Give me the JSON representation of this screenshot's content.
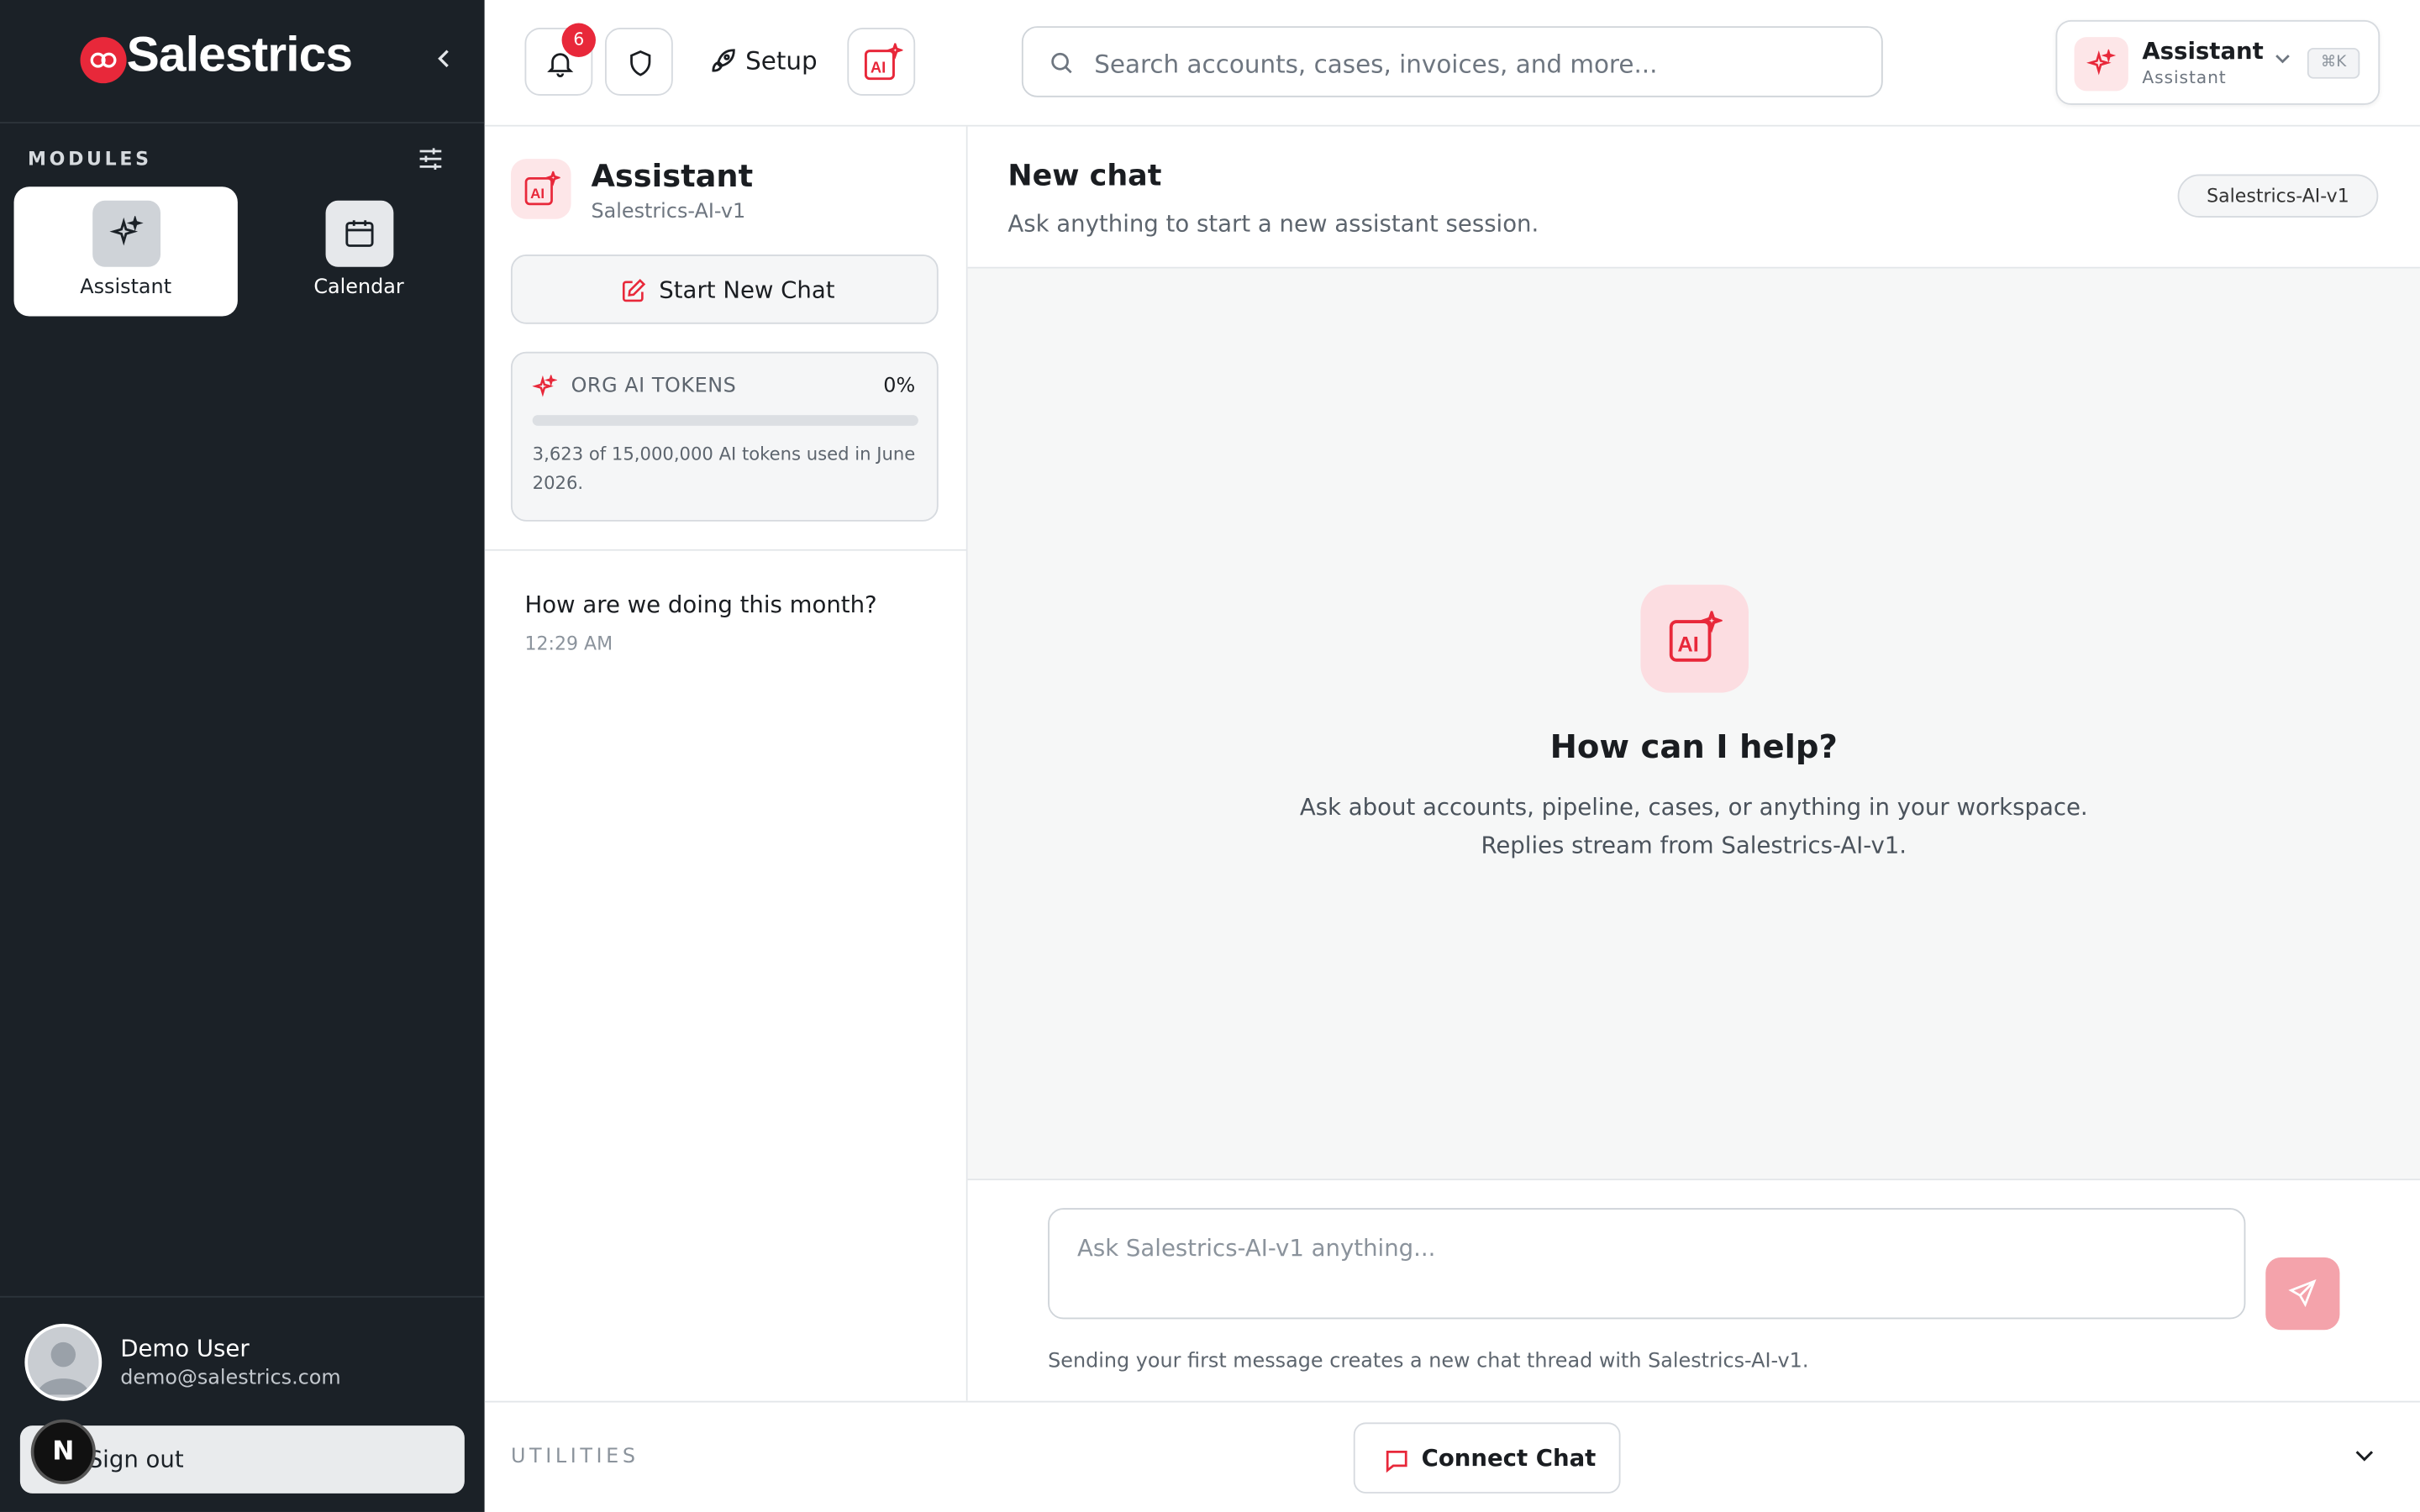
{
  "brand": {
    "name": "Salestrics"
  },
  "sidebar": {
    "modules_label": "MODULES",
    "modules": [
      {
        "label": "Assistant",
        "icon": "sparkles-icon",
        "active": true
      },
      {
        "label": "Calendar",
        "icon": "calendar-icon",
        "active": false
      }
    ],
    "user": {
      "name": "Demo User",
      "email": "demo@salestrics.com"
    },
    "sign_out_label": "Sign out",
    "badge_letter": "N"
  },
  "topbar": {
    "notifications_count": "6",
    "setup_label": "Setup",
    "search_placeholder": "Search accounts, cases, invoices, and more...",
    "switcher": {
      "title": "Assistant",
      "subtitle": "Assistant",
      "shortcut": "⌘K"
    }
  },
  "panel": {
    "title": "Assistant",
    "subtitle": "Salestrics-AI-v1",
    "new_chat_label": "Start New Chat",
    "tokens": {
      "label": "ORG AI TOKENS",
      "percent": "0%",
      "fraction": 0.0002,
      "description": "3,623 of 15,000,000 AI tokens used in June 2026."
    },
    "threads": [
      {
        "title": "How are we doing this month?",
        "time": "12:29 AM"
      }
    ]
  },
  "chat": {
    "title": "New chat",
    "subtitle": "Ask anything to start a new assistant session.",
    "model": "Salestrics-AI-v1",
    "empty_title": "How can I help?",
    "empty_line1": "Ask about accounts, pipeline, cases, or anything in your workspace.",
    "empty_line2": "Replies stream from Salestrics-AI-v1.",
    "composer_placeholder": "Ask Salestrics-AI-v1 anything...",
    "composer_hint": "Sending your first message creates a new chat thread with Salestrics-AI-v1."
  },
  "utilities": {
    "label": "UTILITIES",
    "connect_label": "Connect Chat"
  },
  "colors": {
    "accent": "#e8283a",
    "sidebar_bg": "#1b2127",
    "accent_soft": "#fde6e8"
  }
}
